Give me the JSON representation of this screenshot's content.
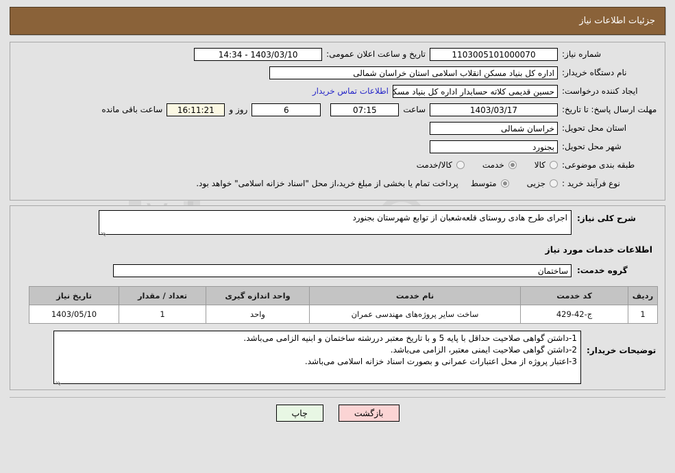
{
  "header": {
    "title": "جزئیات اطلاعات نیاز"
  },
  "top_form": {
    "need_number_label": "شماره نیاز:",
    "need_number_value": "1103005101000070",
    "public_announce_label": "تاریخ و ساعت اعلان عمومی:",
    "public_announce_value": "1403/03/10 - 14:34",
    "buyer_org_label": "نام دستگاه خریدار:",
    "buyer_org_value": "اداره کل بنیاد مسکن انقلاب اسلامی استان خراسان شمالی",
    "creator_label": "ایجاد کننده درخواست:",
    "creator_value": "حسین قدیمی کلاته حسابدار اداره کل بنیاد مسکن انقلاب اسلامی استان خراس",
    "contact_link": "اطلاعات تماس خریدار",
    "deadline_label": "مهلت ارسال پاسخ: تا تاریخ:",
    "deadline_date": "1403/03/17",
    "hour_label": "ساعت",
    "deadline_time": "07:15",
    "days_value": "6",
    "days_label": "روز و",
    "countdown_value": "16:11:21",
    "countdown_label": "ساعت باقی مانده",
    "province_label": "استان محل تحویل:",
    "province_value": "خراسان شمالی",
    "city_label": "شهر محل تحویل:",
    "city_value": "بجنورد",
    "category_label": "طبقه بندی موضوعی:",
    "category_options": [
      {
        "label": "کالا",
        "selected": false
      },
      {
        "label": "خدمت",
        "selected": true
      },
      {
        "label": "کالا/خدمت",
        "selected": false
      }
    ],
    "process_label": "نوع فرآیند خرید :",
    "process_options": [
      {
        "label": "جزیی",
        "selected": false
      },
      {
        "label": "متوسط",
        "selected": true
      }
    ],
    "treasury_note": "پرداخت تمام یا بخشی از مبلغ خرید،از محل \"اسناد خزانه اسلامی\" خواهد بود."
  },
  "description": {
    "label": "شرح کلی نیاز:",
    "value": "اجرای طرح هادی روستای قلعه‌شعبان از توابع شهرستان بجنورد"
  },
  "services_section": {
    "heading": "اطلاعات خدمات مورد نیاز",
    "group_label": "گروه خدمت:",
    "group_value": "ساختمان"
  },
  "table": {
    "columns": [
      "ردیف",
      "کد خدمت",
      "نام خدمت",
      "واحد اندازه گیری",
      "تعداد / مقدار",
      "تاریخ نیاز"
    ],
    "rows": [
      {
        "row": "1",
        "code": "ج-42-429",
        "name": "ساخت سایر پروژه‌های مهندسی عمران",
        "unit": "واحد",
        "qty": "1",
        "date": "1403/05/10"
      }
    ]
  },
  "notes": {
    "label": "توضیحات خریدار:",
    "lines": [
      "1-داشتن گواهی صلاحیت حداقل با پایه 5 و با تاریخ معتبر دررشته ساختمان و ابنیه  الزامی می‌باشد.",
      "2-داشتن گواهی صلاحیت ایمنی معتبر، الزامی می‌باشد.",
      "3-اعتبار پروژه از محل اعتبارات عمرانی و بصورت اسناد خزانه اسلامی می‌باشد."
    ]
  },
  "footer": {
    "print_label": "چاپ",
    "back_label": "بازگشت"
  },
  "watermark": {
    "text": "AriaTender.net"
  },
  "colors": {
    "title_bar": "#8a6239",
    "page_bg": "#e3e3e3",
    "link": "#2727c8",
    "table_header": "#c4c4c4",
    "print_button": "#e8f7e4",
    "back_button": "#fbd4d4",
    "countdown_field": "#fbf8e3"
  }
}
